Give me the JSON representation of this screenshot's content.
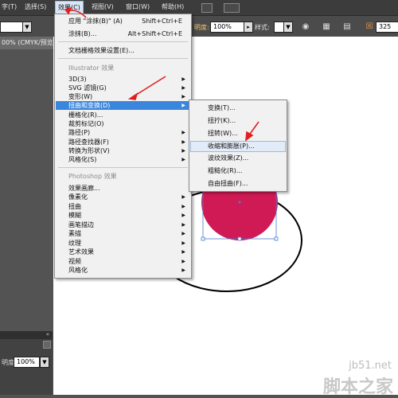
{
  "menubar": {
    "items": [
      "字(T)",
      "选择(S)",
      "效果(C)",
      "视图(V)",
      "窗口(W)",
      "帮助(H)"
    ]
  },
  "controlbar": {
    "opacity_label": "明度:",
    "opacity_value": "100%",
    "style_label": "样式:",
    "right_value": "325"
  },
  "doc_tab": "00% (CMYK/预览",
  "effect_menu": {
    "top_items": [
      {
        "label": "应用 \"涂抹(B)\" (A)",
        "shortcut": "Shift+Ctrl+E"
      },
      {
        "label": "涂抹(B)...",
        "shortcut": "Alt+Shift+Ctrl+E"
      }
    ],
    "doc_raster": "文档栅格效果设置(E)...",
    "illustrator_header": "Illustrator 效果",
    "illustrator_items": [
      "3D(3)",
      "SVG 滤镜(G)",
      "变形(W)",
      "扭曲和变换(D)",
      "栅格化(R)...",
      "裁剪标记(O)",
      "路径(P)",
      "路径查找器(F)",
      "转换为形状(V)",
      "风格化(S)"
    ],
    "photoshop_header": "Photoshop 效果",
    "photoshop_items": [
      "效果画廊...",
      "像素化",
      "扭曲",
      "模糊",
      "画笔描边",
      "素描",
      "纹理",
      "艺术效果",
      "视频",
      "风格化"
    ]
  },
  "distort_submenu": {
    "items": [
      "变换(T)...",
      "扭拧(K)...",
      "扭转(W)...",
      "收缩和膨胀(P)...",
      "波纹效果(Z)...",
      "粗糙化(R)...",
      "自由扭曲(F)..."
    ]
  },
  "bottom_panel": {
    "label": "明度:",
    "value": "100%"
  },
  "watermark": {
    "line1": "jb51.net",
    "line2": "脚本之家"
  },
  "colors": {
    "highlight": "#3a86dc",
    "circle_fill": "#d01a55",
    "arrow": "#e02020"
  }
}
